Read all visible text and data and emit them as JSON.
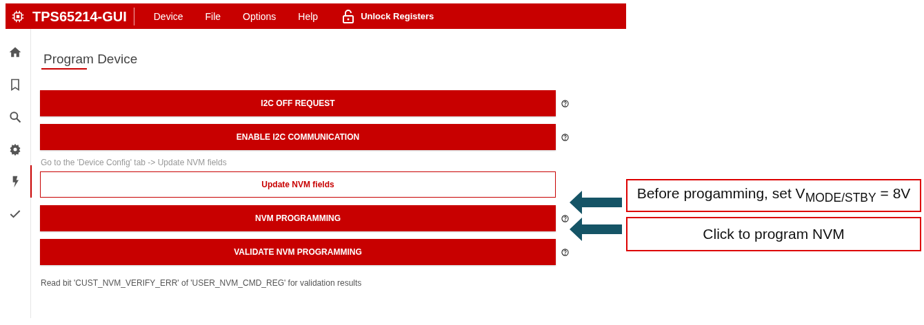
{
  "header": {
    "app_title": "TPS65214-GUI",
    "menu": [
      "Device",
      "File",
      "Options",
      "Help"
    ],
    "unlock_label": "Unlock Registers"
  },
  "sidebar": {
    "items": [
      {
        "selected": false
      },
      {
        "selected": false
      },
      {
        "selected": false
      },
      {
        "selected": false
      },
      {
        "selected": true
      },
      {
        "selected": false
      }
    ]
  },
  "page_title": "Program Device",
  "items": [
    {
      "kind": "button",
      "label": "I2C OFF REQUEST",
      "help": true
    },
    {
      "kind": "button",
      "label": "ENABLE I2C COMMUNICATION",
      "help": true
    },
    {
      "kind": "note",
      "text": "Go to the 'Device Config' tab -> Update NVM fields"
    },
    {
      "kind": "outline_button",
      "label": "Update NVM fields",
      "help": false
    },
    {
      "kind": "button",
      "label": "NVM PROGRAMMING",
      "help": true
    },
    {
      "kind": "button",
      "label": "VALIDATE NVM PROGRAMMING",
      "help": true
    },
    {
      "kind": "note",
      "text": "Read bit 'CUST_NVM_VERIFY_ERR' of 'USER_NVM_CMD_REG' for validation results"
    }
  ],
  "annotations": [
    {
      "text": "Before progamming, set V$_{MODE/STBY}$ = 8V"
    },
    {
      "text": "Click to program NVM"
    }
  ]
}
